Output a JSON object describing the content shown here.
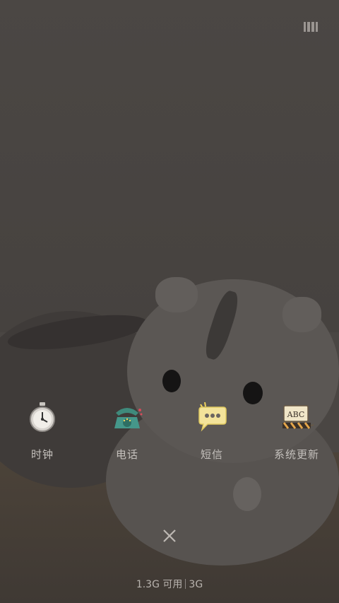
{
  "apps": [
    {
      "label": "时钟",
      "icon": "stopwatch-icon"
    },
    {
      "label": "电话",
      "icon": "rotary-phone-icon"
    },
    {
      "label": "短信",
      "icon": "speech-bubble-icon"
    },
    {
      "label": "系统更新",
      "icon": "clapperboard-icon"
    }
  ],
  "status": {
    "memory": "1.3G 可用",
    "network": "3G"
  },
  "icons": {
    "manage": "recent-apps-manage-icon",
    "close": "close-icon"
  },
  "colors": {
    "overlay": "#4a4643",
    "label": "#c4c0bc",
    "status_text": "#b8b3ae"
  }
}
